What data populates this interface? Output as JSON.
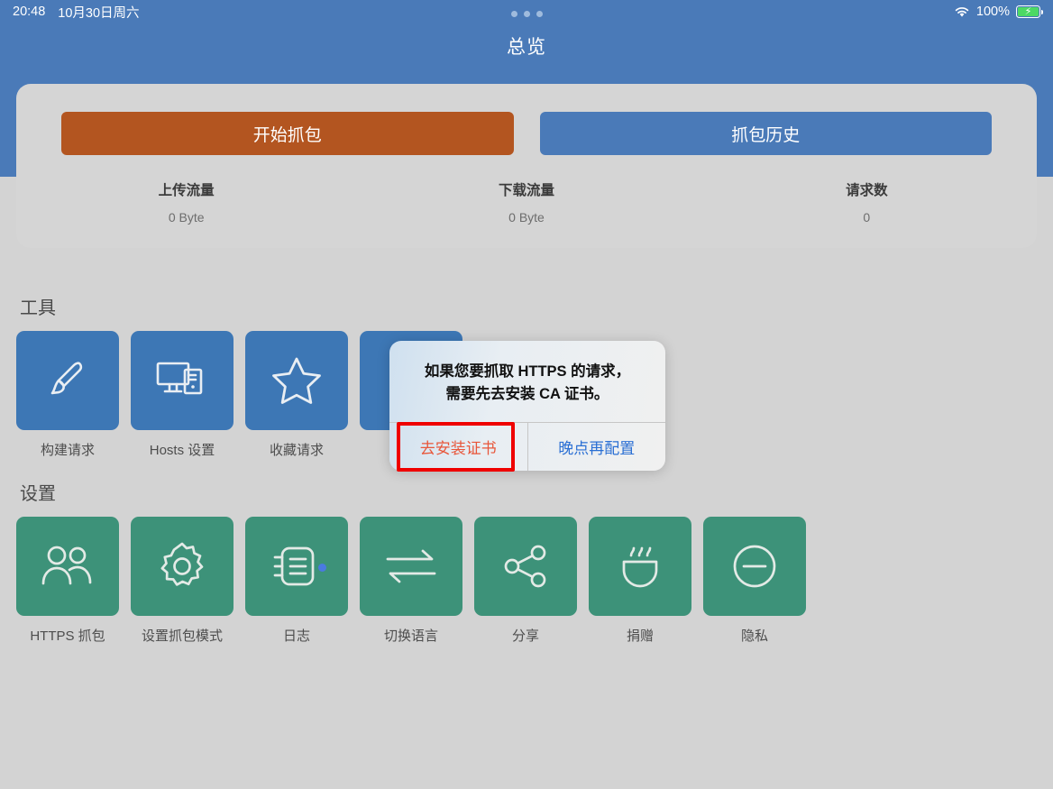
{
  "status_bar": {
    "time": "20:48",
    "date": "10月30日周六",
    "wifi_icon": "wifi-icon",
    "battery_percent": "100%",
    "battery_icon": "battery-charging-icon"
  },
  "nav": {
    "title": "总览",
    "page_dots_icon": "page-dots-icon"
  },
  "summary": {
    "start_capture_label": "开始抓包",
    "history_label": "抓包历史",
    "stats": [
      {
        "label": "上传流量",
        "value": "0 Byte"
      },
      {
        "label": "下载流量",
        "value": "0 Byte"
      },
      {
        "label": "请求数",
        "value": "0"
      }
    ]
  },
  "tools": {
    "title": "工具",
    "items": [
      {
        "label": "构建请求",
        "icon": "paintbrush-icon"
      },
      {
        "label": "Hosts 设置",
        "icon": "desktop-computer-icon"
      },
      {
        "label": "收藏请求",
        "icon": "star-icon"
      },
      {
        "label": "",
        "icon": "hidden-tile-icon"
      }
    ]
  },
  "settings": {
    "title": "设置",
    "items": [
      {
        "label": "HTTPS 抓包",
        "icon": "people-icon"
      },
      {
        "label": "设置抓包模式",
        "icon": "gear-icon"
      },
      {
        "label": "日志",
        "icon": "document-lines-icon",
        "badge": true
      },
      {
        "label": "切换语言",
        "icon": "exchange-arrows-icon"
      },
      {
        "label": "分享",
        "icon": "share-nodes-icon"
      },
      {
        "label": "捐赠",
        "icon": "coffee-cup-icon"
      },
      {
        "label": "隐私",
        "icon": "minus-circle-icon"
      }
    ]
  },
  "alert": {
    "message_line1": "如果您要抓取 HTTPS 的请求，",
    "message_line2": "需要先去安装 CA 证书。",
    "install_label": "去安装证书",
    "later_label": "晚点再配置"
  },
  "colors": {
    "header_blue": "#4a7ab8",
    "tile_blue": "#3d77b5",
    "tile_green": "#3d9279",
    "start_button_orange": "#b35520",
    "page_background": "#d3d3d3",
    "card_background": "#d5d5d5",
    "install_text": "#e8563a",
    "later_text": "#2a6fd4",
    "highlight_border": "#ef0000",
    "badge_blue": "#4a7ae0",
    "battery_green": "#4cd964"
  }
}
